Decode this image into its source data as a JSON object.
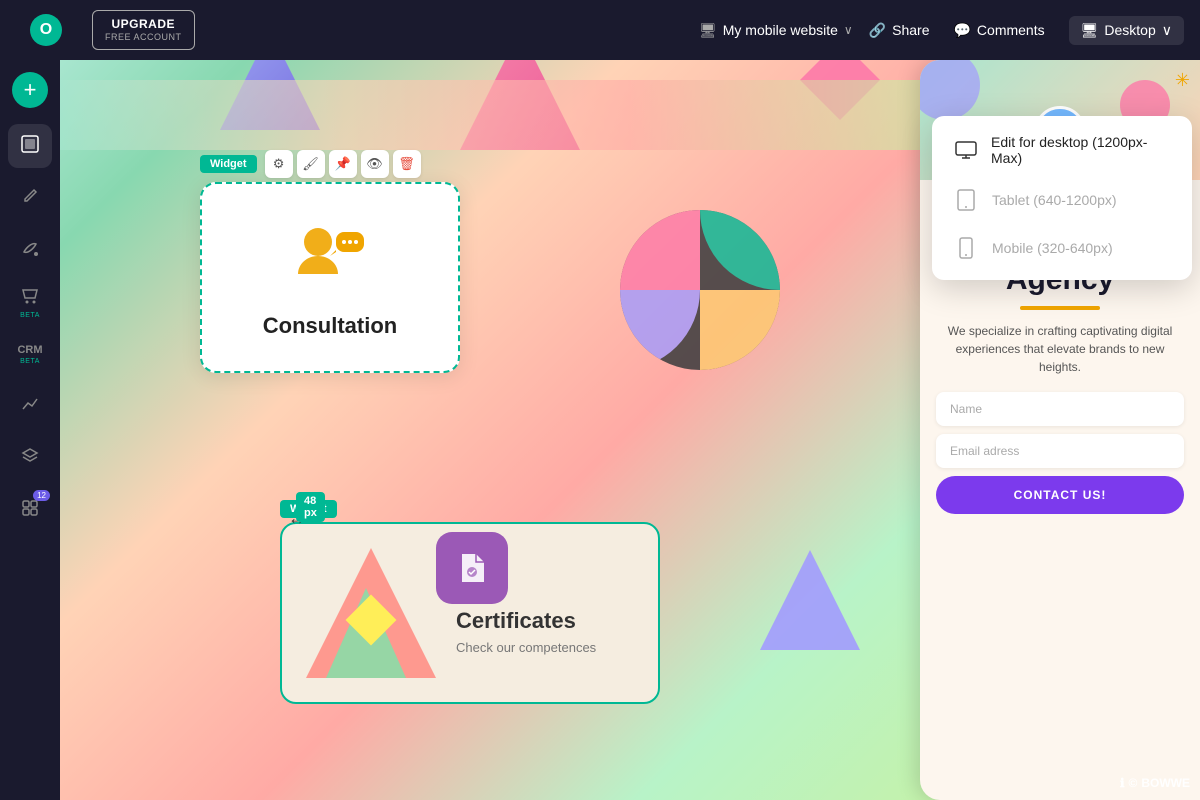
{
  "header": {
    "logo_letter": "O",
    "upgrade_label": "UPGRADE",
    "free_account_label": "FREE ACCOUNT",
    "site_icon": "🖥",
    "site_name": "My mobile website",
    "chevron": "∨",
    "share_label": "Share",
    "comments_label": "Comments",
    "desktop_label": "Desktop",
    "desktop_chevron": "∨"
  },
  "sidebar": {
    "add_icon": "+",
    "items": [
      {
        "name": "pages",
        "icon": "⬜",
        "label": ""
      },
      {
        "name": "edit",
        "icon": "✏️",
        "label": ""
      },
      {
        "name": "paint",
        "icon": "🖌",
        "label": ""
      },
      {
        "name": "shop",
        "icon": "🛒",
        "label": "BETA"
      },
      {
        "name": "crm",
        "icon": "CRM",
        "label": "BETA"
      },
      {
        "name": "analytics",
        "icon": "📈",
        "label": ""
      },
      {
        "name": "layers",
        "icon": "⬛",
        "label": ""
      },
      {
        "name": "apps",
        "icon": "🎁",
        "label": "12"
      }
    ]
  },
  "widget_consultation": {
    "tag": "Widget",
    "title": "Consultation"
  },
  "widget_certificates": {
    "tag": "Widget",
    "px_label": "48 px",
    "title": "Certificates",
    "subtitle": "Check our competences"
  },
  "dropdown": {
    "items": [
      {
        "label": "Edit for desktop (1200px-Max)",
        "icon": "🖥"
      },
      {
        "label": "Tablet (640-1200px)",
        "icon": "▭"
      },
      {
        "label": "Mobile (320-640px)",
        "icon": "📱"
      }
    ]
  },
  "mobile_preview": {
    "title": "Creative\nAgency",
    "description": "We specialize in crafting captivating digital experiences that elevate brands to new heights.",
    "name_placeholder": "Name",
    "email_placeholder": "Email adress",
    "cta_label": "CONTACT US!"
  },
  "bowwe": {
    "label": "BOWWE"
  }
}
